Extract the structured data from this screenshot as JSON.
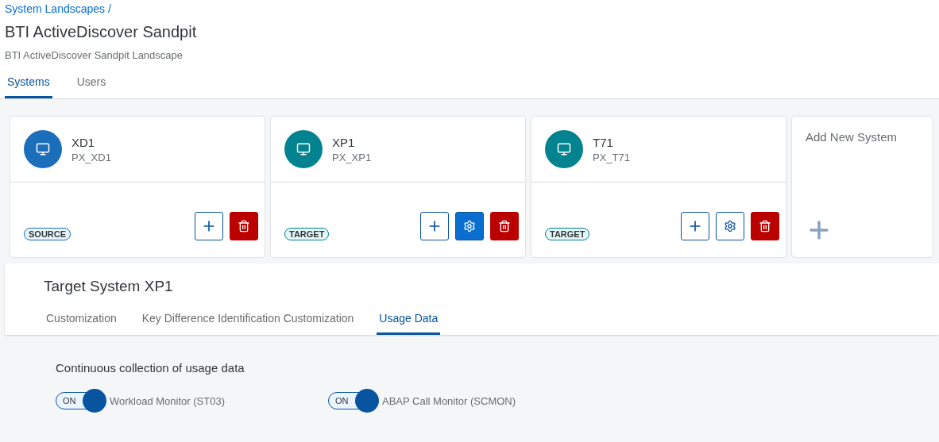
{
  "breadcrumb": {
    "link": "System Landscapes",
    "separator": "/"
  },
  "title": "BTI ActiveDiscover Sandpit",
  "subtitle": "BTI ActiveDiscover Sandpit Landscape",
  "tabs": [
    {
      "label": "Systems",
      "selected": true
    },
    {
      "label": "Users",
      "selected": false
    }
  ],
  "systems": [
    {
      "name": "XD1",
      "id": "PX_XD1",
      "kind": "source",
      "badge": "SOURCE",
      "actions": [
        {
          "kind": "add"
        },
        {
          "kind": "delete"
        }
      ]
    },
    {
      "name": "XP1",
      "id": "PX_XP1",
      "kind": "target",
      "badge": "TARGET",
      "actions": [
        {
          "kind": "add"
        },
        {
          "kind": "settings",
          "selected": true
        },
        {
          "kind": "delete"
        }
      ]
    },
    {
      "name": "T71",
      "id": "PX_T71",
      "kind": "target",
      "badge": "TARGET",
      "actions": [
        {
          "kind": "add"
        },
        {
          "kind": "settings",
          "selected": false
        },
        {
          "kind": "delete"
        }
      ]
    }
  ],
  "add_system": {
    "label": "Add New System"
  },
  "detail": {
    "title": "Target System XP1",
    "tabs": [
      {
        "label": "Customization",
        "selected": false
      },
      {
        "label": "Key Difference Identification Customization",
        "selected": false
      },
      {
        "label": "Usage Data",
        "selected": true
      }
    ],
    "section_title": "Continuous collection of usage data",
    "switches": [
      {
        "state_text": "ON",
        "on": true,
        "label": "Workload Monitor (ST03)"
      },
      {
        "state_text": "ON",
        "on": true,
        "label": "ABAP Call Monitor (SCMON)"
      }
    ]
  }
}
